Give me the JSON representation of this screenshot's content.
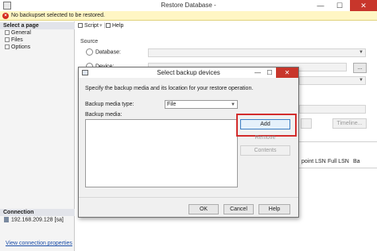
{
  "window": {
    "title": "Restore Database -",
    "minimize": "—",
    "maximize": "☐",
    "close": "✕"
  },
  "warning": {
    "text": "No backupset selected to be restored."
  },
  "left_pane": {
    "select_page_header": "Select a page",
    "pages": [
      "General",
      "Files",
      "Options"
    ],
    "connection_header": "Connection",
    "server": "192.168.209.128 [sa]",
    "view_connection_link": "View connection properties"
  },
  "toolbar": {
    "script_label": "Script",
    "help_label": "Help"
  },
  "main": {
    "source_label": "Source",
    "database_option": "Database:",
    "device_option": "Device:",
    "browse_label": "...",
    "timeline_label": "Timeline...",
    "columns": [
      "point LSN",
      "Full LSN",
      "Ba"
    ]
  },
  "dialog": {
    "title": "Select backup devices",
    "minimize": "—",
    "maximize": "☐",
    "close": "✕",
    "description": "Specify the backup media and its location for your restore operation.",
    "media_type_label": "Backup media type:",
    "media_type_value": "File",
    "media_label": "Backup media:",
    "add_label": "Add",
    "remove_label": "Remove",
    "contents_label": "Contents",
    "ok_label": "OK",
    "cancel_label": "Cancel",
    "help_label": "Help"
  },
  "colors": {
    "highlight": "#d32c2c",
    "close_button": "#c8362b",
    "warning_bg": "#fff6c4",
    "link": "#1b4ea8"
  }
}
